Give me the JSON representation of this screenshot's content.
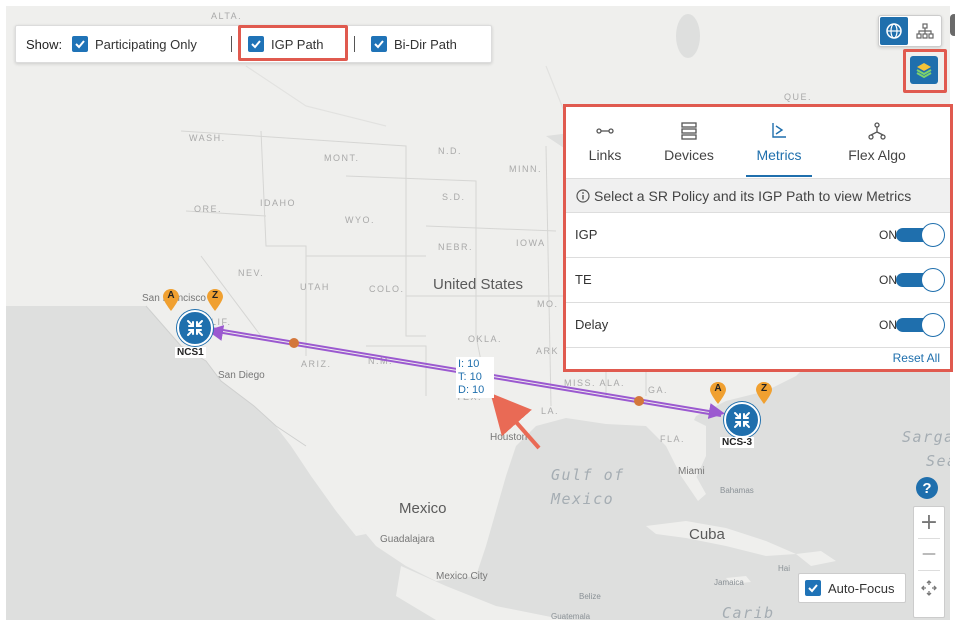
{
  "show_bar": {
    "label": "Show:",
    "options": [
      {
        "label": "Participating Only",
        "checked": true
      },
      {
        "label": "IGP Path",
        "checked": true,
        "highlighted": true
      },
      {
        "label": "Bi-Dir Path",
        "checked": true
      }
    ]
  },
  "top_controls": {
    "view_icons": [
      "globe-icon",
      "topology-icon"
    ],
    "layers_icon": "layers-icon"
  },
  "panel": {
    "tabs": [
      {
        "label": "Links",
        "icon": "links-icon",
        "active": false
      },
      {
        "label": "Devices",
        "icon": "devices-icon",
        "active": false
      },
      {
        "label": "Metrics",
        "icon": "metrics-icon",
        "active": true
      },
      {
        "label": "Flex Algo",
        "icon": "flex-algo-icon",
        "active": false
      }
    ],
    "info_text": "Select a SR Policy and its IGP Path to view Metrics",
    "metrics": [
      {
        "name": "IGP",
        "state": "ON",
        "on": true
      },
      {
        "name": "TE",
        "state": "ON",
        "on": true
      },
      {
        "name": "Delay",
        "state": "ON",
        "on": true
      }
    ],
    "reset_label": "Reset All"
  },
  "map": {
    "country_labels": {
      "us": "United States",
      "mexico": "Mexico",
      "cuba": "Cuba"
    },
    "state_labels": {
      "wash": "WASH.",
      "mont": "MONT.",
      "nd": "N.D.",
      "minn": "MINN.",
      "ore": "ORE.",
      "idaho": "IDAHO",
      "sd": "S.D.",
      "wyo": "WYO.",
      "nebr": "NEBR.",
      "iowa": "IOWA",
      "nev": "NEV.",
      "utah": "UTAH",
      "colo": "COLO.",
      "mo": "MO.",
      "calif": "LIF.",
      "okla": "OKLA.",
      "ark": "ARK",
      "ariz": "ARIZ.",
      "nm": "N.M.",
      "miss_ala": "MISS. ALA.",
      "ga": "GA.",
      "tex": "TEX.",
      "la": "LA.",
      "fla": "FLA.",
      "que": "QUE."
    },
    "city_labels": {
      "san_francisco": "San Francisco",
      "san_diego": "San Diego",
      "houston": "Houston",
      "guadalajara": "Guadalajara",
      "mexico_city": "Mexico City",
      "miami": "Miami",
      "bahamas": "Bahamas",
      "jamaica": "Jamaica",
      "belize": "Belize",
      "guatemala": "Guatemala",
      "haiti": "Hai"
    },
    "sea_labels": {
      "gulf1": "Gulf of",
      "gulf2": "Mexico",
      "sarga": "Sarga",
      "sea": "Sea",
      "caribb": "Carib"
    },
    "nodes": [
      {
        "name": "NCS1",
        "pins": [
          "A",
          "Z"
        ]
      },
      {
        "name": "NCS-3",
        "pins": [
          "A",
          "Z"
        ]
      }
    ],
    "metric_label": [
      "I: 10",
      "T: 10",
      "D: 10"
    ],
    "link_color": "#9b59d0",
    "node_color": "#1f6fad",
    "pin_color": "#f0a030",
    "highlight_color": "#e05a4f"
  },
  "bottom_controls": {
    "help": "?",
    "zoom_in": "+",
    "zoom_out": "—",
    "autofocus_label": "Auto-Focus",
    "autofocus_checked": true
  }
}
